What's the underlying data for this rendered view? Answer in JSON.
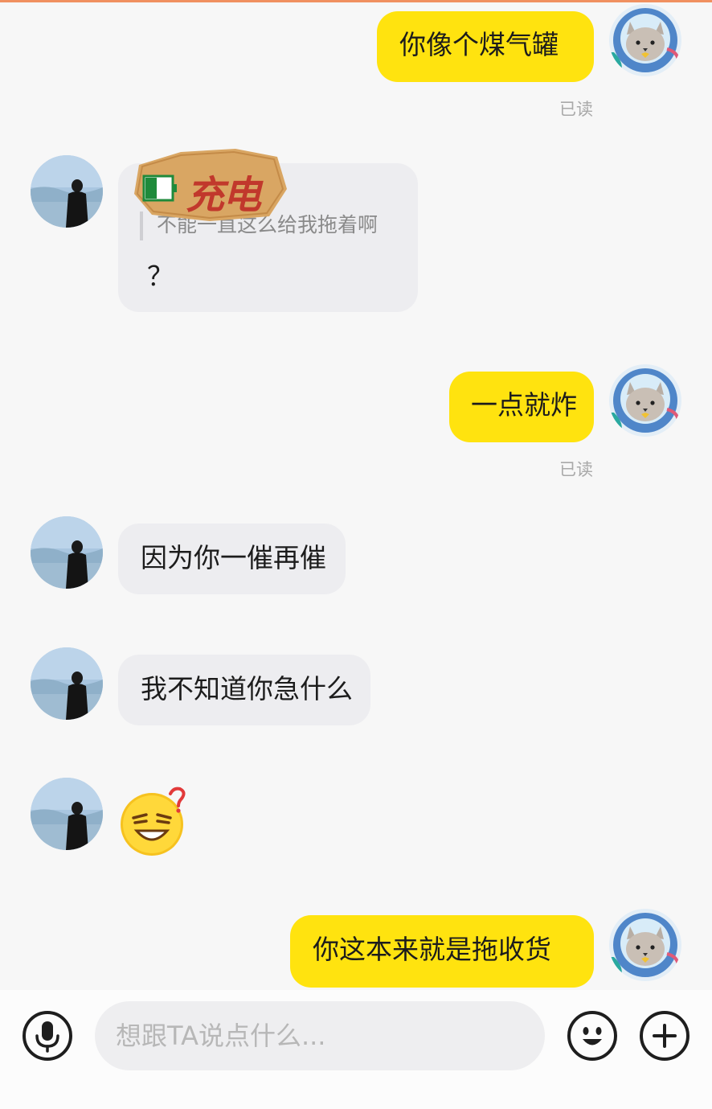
{
  "messages": {
    "m1": {
      "text": "你像个煤气罐",
      "status": "已读"
    },
    "m2": {
      "sticker_text": "充电",
      "quote": "不能一直这么给我拖着啊",
      "text": "？"
    },
    "m3": {
      "text": "一点就炸",
      "status": "已读"
    },
    "m4": {
      "text": "因为你一催再催"
    },
    "m5": {
      "text": "我不知道你急什么"
    },
    "m6": {
      "emoji": "sleepy-grin-emoji"
    },
    "m7": {
      "text": "你这本来就是拖收货"
    }
  },
  "input": {
    "placeholder": "想跟TA说点什么..."
  },
  "icons": {
    "voice": "microphone-icon",
    "emoji": "smiley-icon",
    "more": "plus-icon"
  },
  "colors": {
    "my_bubble": "#ffe30f",
    "their_bubble": "#ededf0",
    "sticker": "#d9a663",
    "sticker_text": "#c1382c",
    "battery": "#1f8a3b"
  }
}
